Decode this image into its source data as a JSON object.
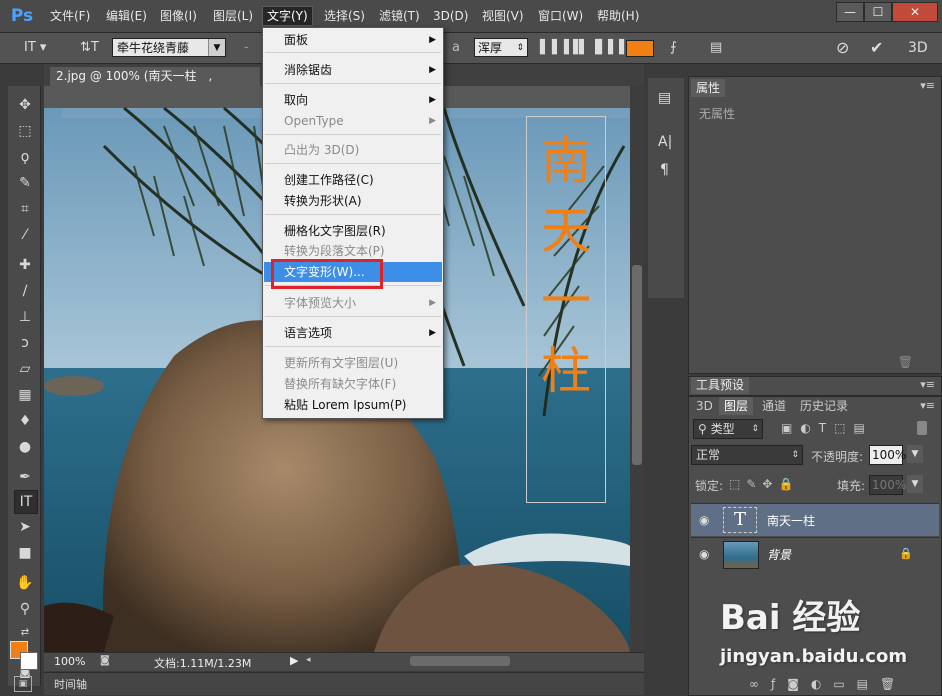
{
  "app": {
    "logo": "Ps",
    "menus": [
      "文件(F)",
      "编辑(E)",
      "图像(I)",
      "图层(L)",
      "文字(Y)",
      "选择(S)",
      "滤镜(T)",
      "3D(D)",
      "视图(V)",
      "窗口(W)",
      "帮助(H)"
    ],
    "window_buttons": [
      "—",
      "☐",
      "✕"
    ]
  },
  "options_bar": {
    "font_family": "牵牛花绕青藤",
    "font_style": "-",
    "aa_label": "a",
    "antialias": "浑厚",
    "text_color": "#f07f14",
    "mode_3d": "3D"
  },
  "document": {
    "tab_title": "2.jpg @ 100% (南天一柱　, RGB/8#) *",
    "overlay_text": [
      "南",
      "天",
      "一",
      "柱"
    ],
    "text_color": "#f07f14"
  },
  "status_bar": {
    "zoom": "100%",
    "doc_info": "文档:1.11M/1.23M",
    "timeline_label": "时间轴"
  },
  "text_menu": {
    "items": [
      {
        "label": "面板",
        "submenu": true,
        "disabled": false
      },
      {
        "label": "消除锯齿",
        "submenu": true,
        "disabled": false
      },
      {
        "label": "取向",
        "submenu": true,
        "disabled": false
      },
      {
        "label": "OpenType",
        "submenu": true,
        "disabled": true
      },
      {
        "label": "凸出为 3D(D)",
        "submenu": false,
        "disabled": true
      },
      {
        "label": "创建工作路径(C)",
        "submenu": false,
        "disabled": false
      },
      {
        "label": "转换为形状(A)",
        "submenu": false,
        "disabled": false
      },
      {
        "label": "栅格化文字图层(R)",
        "submenu": false,
        "disabled": false
      },
      {
        "label": "转换为段落文本(P)",
        "submenu": false,
        "disabled": true
      },
      {
        "label": "文字变形(W)...",
        "submenu": false,
        "disabled": false,
        "highlighted": true
      },
      {
        "label": "字体预览大小",
        "submenu": true,
        "disabled": true
      },
      {
        "label": "语言选项",
        "submenu": true,
        "disabled": false
      },
      {
        "label": "更新所有文字图层(U)",
        "submenu": false,
        "disabled": true
      },
      {
        "label": "替换所有缺欠字体(F)",
        "submenu": false,
        "disabled": true
      },
      {
        "label": "粘贴 Lorem Ipsum(P)",
        "submenu": false,
        "disabled": false
      }
    ]
  },
  "properties_panel": {
    "tab": "属性",
    "empty_text": "无属性"
  },
  "tool_presets_panel": {
    "tab": "工具预设"
  },
  "layers_panel": {
    "tabs": [
      "3D",
      "图层",
      "通道",
      "历史记录"
    ],
    "filter_kind": "类型",
    "blend_mode": "正常",
    "opacity_label": "不透明度:",
    "opacity_value": "100%",
    "lock_label": "锁定:",
    "fill_label": "填充:",
    "fill_value": "100%",
    "layers": [
      {
        "name": "南天一柱",
        "type": "text",
        "thumb": "T",
        "selected": true
      },
      {
        "name": "背景",
        "type": "image",
        "selected": false,
        "locked": true
      }
    ]
  },
  "watermark": {
    "brand": "Bai 经验",
    "url": "jingyan.baidu.com"
  }
}
